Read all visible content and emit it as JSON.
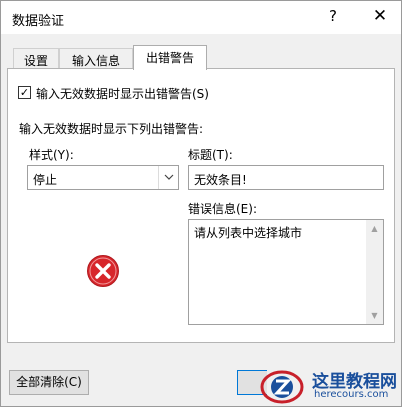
{
  "window": {
    "title": "数据验证",
    "help_glyph": "?",
    "close_glyph": "✕"
  },
  "tabs": [
    {
      "label": "设置"
    },
    {
      "label": "输入信息"
    },
    {
      "label": "出错警告"
    }
  ],
  "error_alert": {
    "show_checkbox_label": "输入无效数据时显示出错警告(S)",
    "show_checked": true,
    "check_glyph": "✓",
    "section_label": "输入无效数据时显示下列出错警告:",
    "style_label": "样式(Y):",
    "style_value": "停止",
    "title_label": "标题(T):",
    "title_value": "无效条目!",
    "message_label": "错误信息(E):",
    "message_value": "请从列表中选择城市"
  },
  "footer": {
    "clear_all_label": "全部清除(C)"
  },
  "watermark": {
    "name": "这里教程网",
    "url": "herecours.com"
  },
  "colors": {
    "accent": "#0078d7",
    "error_red": "#d7262b",
    "watermark_blue": "#1a4f9c"
  },
  "icons": {
    "style_dropdown": "chevron-down-icon",
    "alert_style": "error-stop-icon"
  }
}
